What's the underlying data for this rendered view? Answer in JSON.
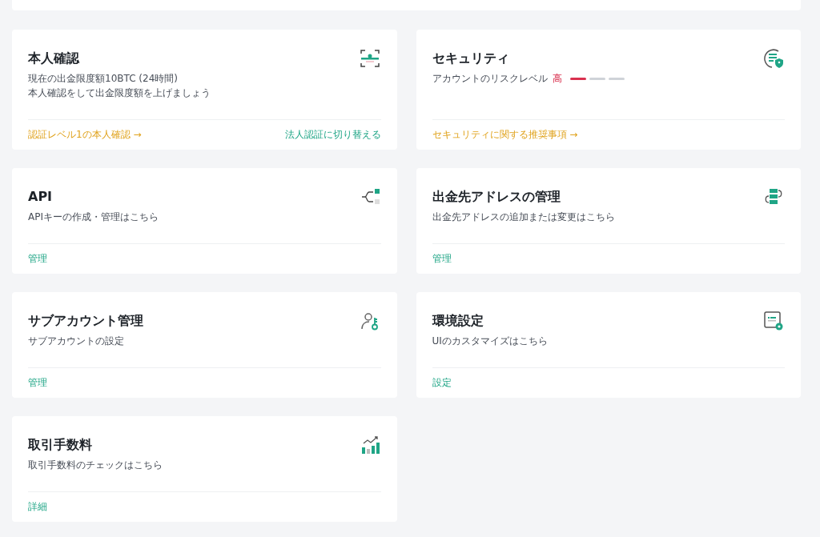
{
  "cards": [
    {
      "kind": "id",
      "title": "本人確認",
      "description": [
        "現在の出金限度額10BTC (24時間)",
        "本人確認をして出金限度額を上げましょう"
      ],
      "links": [
        {
          "label": "認証レベル1の本人確認 →",
          "kind": "warning"
        },
        {
          "label": "法人認証に切り替える",
          "kind": "plain"
        }
      ]
    },
    {
      "kind": "security",
      "title": "セキュリティ",
      "description": [
        "アカウントのリスクレベル"
      ],
      "risk": {
        "label": "高",
        "segments": [
          {
            "on": true
          },
          {
            "on": false
          },
          {
            "on": false
          }
        ]
      },
      "links": [
        {
          "label": "セキュリティに関する推奨事項 →",
          "kind": "warning"
        }
      ]
    },
    {
      "kind": "api",
      "title": "API",
      "description": [
        "APIキーの作成・管理はこちら"
      ],
      "links": [
        {
          "label": "管理",
          "kind": "plain"
        }
      ]
    },
    {
      "kind": "address",
      "title": "出金先アドレスの管理",
      "description": [
        "出金先アドレスの追加または変更はこちら"
      ],
      "links": [
        {
          "label": "管理",
          "kind": "plain"
        }
      ]
    },
    {
      "kind": "subaccount",
      "title": "サブアカウント管理",
      "description": [
        "サブアカウントの設定"
      ],
      "links": [
        {
          "label": "管理",
          "kind": "plain"
        }
      ]
    },
    {
      "kind": "settings",
      "title": "環境設定",
      "description": [
        "UIのカスタマイズはこちら"
      ],
      "links": [
        {
          "label": "設定",
          "kind": "plain"
        }
      ]
    },
    {
      "kind": "fees",
      "title": "取引手数料",
      "description": [
        "取引手数料のチェックはこちら"
      ],
      "links": [
        {
          "label": "詳細",
          "kind": "plain"
        }
      ]
    }
  ]
}
